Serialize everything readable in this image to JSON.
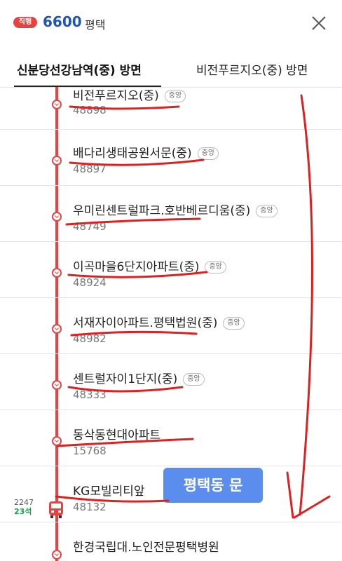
{
  "header": {
    "badge": "직행",
    "route_number": "6600",
    "city": "평택",
    "close_icon": "close-icon"
  },
  "tabs": [
    {
      "label": "신분당선강남역(중) 방면",
      "active": true
    },
    {
      "label": "비전푸르지오(중) 방면",
      "active": false
    }
  ],
  "stops": [
    {
      "name": "비전푸르지오(중)",
      "code": "48898",
      "tag": "중앙"
    },
    {
      "name": "배다리생태공원서문(중)",
      "code": "48897",
      "tag": "중앙"
    },
    {
      "name": "우미린센트럴파크.호반베르디움(중)",
      "code": "48749",
      "tag": "중앙"
    },
    {
      "name": "이곡마을6단지아파트(중)",
      "code": "48924",
      "tag": "중앙"
    },
    {
      "name": "서재자이아파트.평택법원(중)",
      "code": "48982",
      "tag": "중앙"
    },
    {
      "name": "센트럴자이1단지(중)",
      "code": "48333",
      "tag": "중앙"
    },
    {
      "name": "동삭동현대아파트",
      "code": "15768",
      "tag": ""
    },
    {
      "name": "KG모빌리티앞",
      "code": "48132",
      "tag": ""
    },
    {
      "name": "한경국립대.노인전문평택병원",
      "code": "",
      "tag": ""
    }
  ],
  "bus": {
    "plate_suffix": "2247",
    "seats": "23석",
    "icon": "bus-icon"
  },
  "annotation": {
    "note": "평택동 문"
  },
  "colors": {
    "accent_red": "#e9413f",
    "route_blue": "#1f56b4",
    "note_blue": "#5b8def"
  }
}
